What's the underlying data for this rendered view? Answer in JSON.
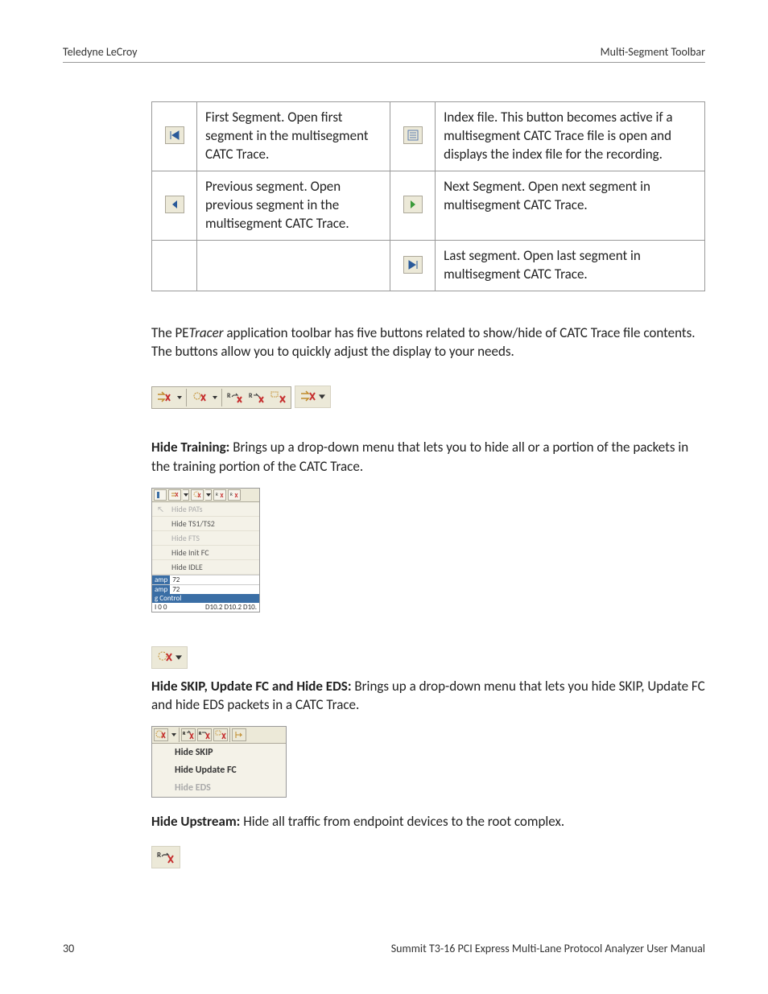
{
  "header": {
    "left": "Teledyne LeCroy",
    "right": "Multi-Segment Toolbar"
  },
  "table": {
    "r1c1": "First Segment. Open first segment in the multisegment CATC Trace.",
    "r1c2": "Index file. This button becomes active if a multisegment CATC Trace file is open and displays the index file for the recording.",
    "r2c1": "Previous segment. Open previous segment in the multisegment CATC Trace.",
    "r2c2": "Next Segment. Open next segment in multisegment CATC Trace.",
    "r3c2": "Last segment. Open last segment in multisegment CATC Trace."
  },
  "intro": {
    "pre": "The PE",
    "italic": "Tracer",
    "post": " application toolbar has five buttons related to show/hide of CATC Trace file contents. The buttons allow you to quickly adjust the display to your needs."
  },
  "hideTraining": {
    "title": "Hide Training:",
    "body": " Brings up a drop-down menu that lets you to hide all or a portion of the packets in the training portion of the CATC Trace."
  },
  "menu1": {
    "items": [
      "Hide PATs",
      "Hide TS1/TS2",
      "Hide FTS",
      "Hide Init FC",
      "Hide IDLE"
    ],
    "rowLabel": "amp",
    "rowNums": [
      "72",
      "72"
    ],
    "foot": "g Control",
    "foot2a": "I 0 0",
    "foot2b": "D10.2 D10.2 D10."
  },
  "hideSkip": {
    "title": "Hide SKIP, Update FC and Hide EDS:",
    "body": " Brings up a drop-down menu that lets you hide SKIP, Update FC and hide EDS packets in a CATC Trace."
  },
  "menu2": {
    "items": [
      "Hide SKIP",
      "Hide Update FC",
      "Hide EDS"
    ]
  },
  "hideUpstream": {
    "title": "Hide Upstream:",
    "body": " Hide all traffic from endpoint devices to the root complex."
  },
  "footer": {
    "page": "30",
    "title": "Summit T3-16 PCI Express Multi-Lane Protocol Analyzer User Manual"
  }
}
